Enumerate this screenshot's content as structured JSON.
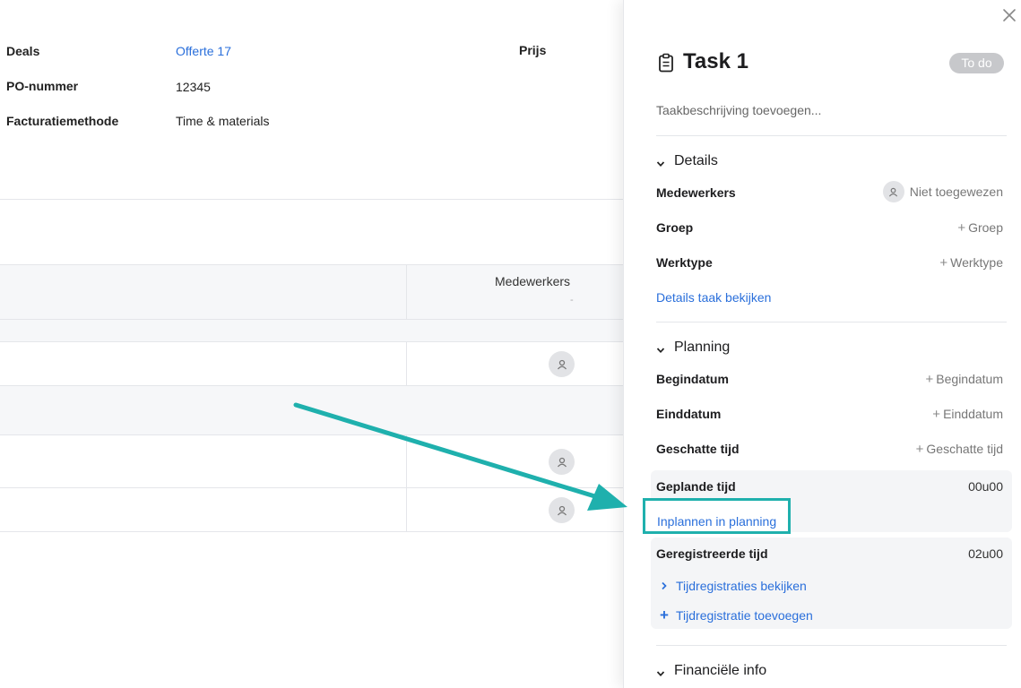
{
  "background_page": {
    "info": [
      {
        "label": "Deals",
        "value": "Offerte 17"
      },
      {
        "label": "PO-nummer",
        "value": "12345"
      },
      {
        "label": "Facturatiemethode",
        "value": "Time & materials"
      }
    ],
    "price_label": "Prijs",
    "table": {
      "column_header": "Medewerkers",
      "column_header_sub": "-"
    }
  },
  "panel": {
    "close_icon": "close-icon",
    "task_icon": "clipboard-icon",
    "title": "Task 1",
    "status": "To do",
    "description_placeholder": "Taakbeschrijving toevoegen...",
    "details": {
      "heading": "Details",
      "medewerkers_label": "Medewerkers",
      "medewerkers_value": "Niet toegewezen",
      "groep_label": "Groep",
      "groep_value": "Groep",
      "werktype_label": "Werktype",
      "werktype_value": "Werktype",
      "link": "Details taak bekijken"
    },
    "planning": {
      "heading": "Planning",
      "begindatum_label": "Begindatum",
      "begindatum_value": "Begindatum",
      "einddatum_label": "Einddatum",
      "einddatum_value": "Einddatum",
      "geschatte_label": "Geschatte tijd",
      "geschatte_value": "Geschatte tijd",
      "geplande_label": "Geplande tijd",
      "geplande_value": "00u00",
      "inplannen_link": "Inplannen in planning",
      "geregistreerde_label": "Geregistreerde tijd",
      "geregistreerde_value": "02u00",
      "bekijken_link": "Tijdregistraties bekijken",
      "toevoegen_link": "Tijdregistratie toevoegen"
    },
    "financieel": {
      "heading": "Financiële info"
    }
  },
  "colors": {
    "link": "#2a6fdb",
    "annotation_arrow": "#1fb0ad",
    "status_badge_bg": "#c7c8cb"
  }
}
